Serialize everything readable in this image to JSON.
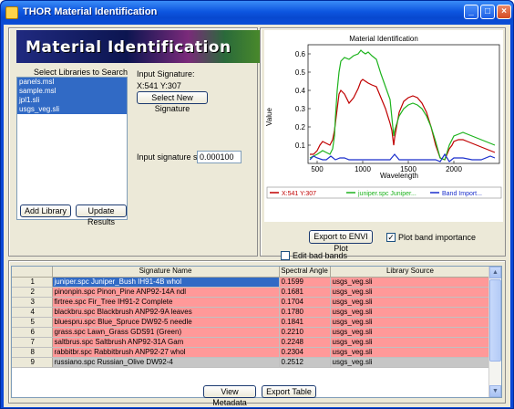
{
  "window": {
    "title": "THOR Material Identification"
  },
  "banner": {
    "text": "Material Identification"
  },
  "libraries": {
    "label": "Select Libraries to Search",
    "items": [
      "panels.msl",
      "sample.msl",
      "jpl1.sli",
      "usgs_veg.sli"
    ],
    "add_button": "Add Library",
    "update_button": "Update Results"
  },
  "signature": {
    "label": "Input Signature:",
    "coords": "X:541 Y:307",
    "select_button": "Select New Signature",
    "scale_label": "Input signature scale:",
    "scale_value": "0.000100"
  },
  "chart_data": {
    "type": "line",
    "title": "Material Identification",
    "xlabel": "Wavelength",
    "ylabel": "Value",
    "xlim": [
      400,
      2500
    ],
    "ylim": [
      0,
      0.65
    ],
    "xticks": [
      500,
      1000,
      1500,
      2000
    ],
    "yticks": [
      0.1,
      0.2,
      0.3,
      0.4,
      0.5,
      0.6
    ],
    "legend": [
      "X:541 Y:307",
      "juniper.spc Juniper...",
      "Band Import..."
    ],
    "colors": {
      "red": "#c00000",
      "green": "#1db31d",
      "blue": "#1a2fcc"
    },
    "series": [
      {
        "name": "X:541 Y:307",
        "color": "#c00000",
        "x": [
          420,
          460,
          500,
          530,
          560,
          600,
          640,
          670,
          690,
          700,
          720,
          740,
          760,
          800,
          850,
          900,
          950,
          980,
          1000,
          1030,
          1060,
          1100,
          1150,
          1200,
          1250,
          1300,
          1320,
          1340,
          1350,
          1400,
          1450,
          1500,
          1550,
          1600,
          1650,
          1700,
          1750,
          1800,
          1850,
          1900,
          1950,
          1980,
          2000,
          2050,
          2100,
          2150,
          2200,
          2250,
          2300,
          2350,
          2400,
          2450
        ],
        "y": [
          0.05,
          0.05,
          0.07,
          0.1,
          0.12,
          0.11,
          0.1,
          0.13,
          0.18,
          0.22,
          0.3,
          0.38,
          0.4,
          0.38,
          0.33,
          0.36,
          0.41,
          0.45,
          0.46,
          0.45,
          0.44,
          0.43,
          0.42,
          0.36,
          0.3,
          0.22,
          0.18,
          0.1,
          0.14,
          0.28,
          0.34,
          0.36,
          0.37,
          0.36,
          0.33,
          0.28,
          0.2,
          0.1,
          0.03,
          0.02,
          0.08,
          0.1,
          0.12,
          0.13,
          0.13,
          0.12,
          0.11,
          0.1,
          0.09,
          0.08,
          0.07,
          0.06
        ]
      },
      {
        "name": "juniper.spc Juniper...",
        "color": "#1db31d",
        "x": [
          420,
          460,
          500,
          530,
          560,
          600,
          640,
          670,
          690,
          700,
          720,
          740,
          760,
          800,
          850,
          900,
          950,
          980,
          1000,
          1030,
          1060,
          1100,
          1150,
          1200,
          1250,
          1300,
          1320,
          1340,
          1350,
          1400,
          1450,
          1500,
          1550,
          1600,
          1650,
          1700,
          1750,
          1800,
          1850,
          1900,
          1950,
          1980,
          2000,
          2050,
          2100,
          2150,
          2200,
          2250,
          2300,
          2350,
          2400,
          2450
        ],
        "y": [
          0.03,
          0.04,
          0.05,
          0.06,
          0.07,
          0.06,
          0.05,
          0.08,
          0.15,
          0.25,
          0.4,
          0.5,
          0.56,
          0.58,
          0.57,
          0.59,
          0.6,
          0.62,
          0.61,
          0.6,
          0.61,
          0.59,
          0.57,
          0.49,
          0.42,
          0.35,
          0.25,
          0.15,
          0.18,
          0.26,
          0.3,
          0.32,
          0.33,
          0.32,
          0.3,
          0.26,
          0.2,
          0.12,
          0.03,
          0.02,
          0.1,
          0.13,
          0.15,
          0.16,
          0.17,
          0.16,
          0.15,
          0.14,
          0.13,
          0.12,
          0.11,
          0.1
        ]
      },
      {
        "name": "Band Import...",
        "color": "#1a2fcc",
        "x": [
          420,
          460,
          500,
          560,
          600,
          650,
          700,
          750,
          800,
          850,
          900,
          950,
          1000,
          1050,
          1100,
          1150,
          1200,
          1250,
          1300,
          1350,
          1400,
          1450,
          1500,
          1600,
          1700,
          1800,
          1850,
          1900,
          1950,
          2000,
          2100,
          2200,
          2300,
          2400,
          2450
        ],
        "y": [
          0.02,
          0.04,
          0.03,
          0.02,
          0.02,
          0.04,
          0.02,
          0.03,
          0.03,
          0.02,
          0.02,
          0.02,
          0.02,
          0.02,
          0.02,
          0.02,
          0.02,
          0.02,
          0.02,
          0.05,
          0.02,
          0.02,
          0.02,
          0.02,
          0.02,
          0.02,
          0.01,
          0.05,
          0.01,
          0.03,
          0.03,
          0.02,
          0.02,
          0.04,
          0.03
        ]
      }
    ]
  },
  "plot_controls": {
    "export_button": "Export to ENVI Plot",
    "plot_band_importance": "Plot band importance",
    "edit_bad_bands": "Edit bad bands"
  },
  "results": {
    "headers": [
      "Signature Name",
      "Spectral Angle",
      "Library Source"
    ],
    "rows": [
      [
        "1",
        "juniper.spc Juniper_Bush IH91-4B whol",
        "0.1599",
        "usgs_veg.sli"
      ],
      [
        "2",
        "pinonpin.spc Pinon_Pine ANP92-14A ndl",
        "0.1681",
        "usgs_veg.sli"
      ],
      [
        "3",
        "firtree.spc Fir_Tree IH91-2 Complete",
        "0.1704",
        "usgs_veg.sli"
      ],
      [
        "4",
        "blackbru.spc Blackbrush ANP92-9A leaves",
        "0.1780",
        "usgs_veg.sli"
      ],
      [
        "5",
        "bluespru.spc Blue_Spruce DW92-5 needle",
        "0.1841",
        "usgs_veg.sli"
      ],
      [
        "6",
        "grass.spc Lawn_Grass GDS91 (Green)",
        "0.2210",
        "usgs_veg.sli"
      ],
      [
        "7",
        "saltbrus.spc Saltbrush ANP92-31A Gam",
        "0.2248",
        "usgs_veg.sli"
      ],
      [
        "8",
        "rabbitbr.spc Rabbitbrush ANP92-27 whol",
        "0.2304",
        "usgs_veg.sli"
      ],
      [
        "9",
        "russiano.spc Russian_Olive DW92-4",
        "0.2512",
        "usgs_veg.sli"
      ]
    ],
    "view_metadata_button": "View Metadata",
    "export_table_button": "Export Table"
  }
}
